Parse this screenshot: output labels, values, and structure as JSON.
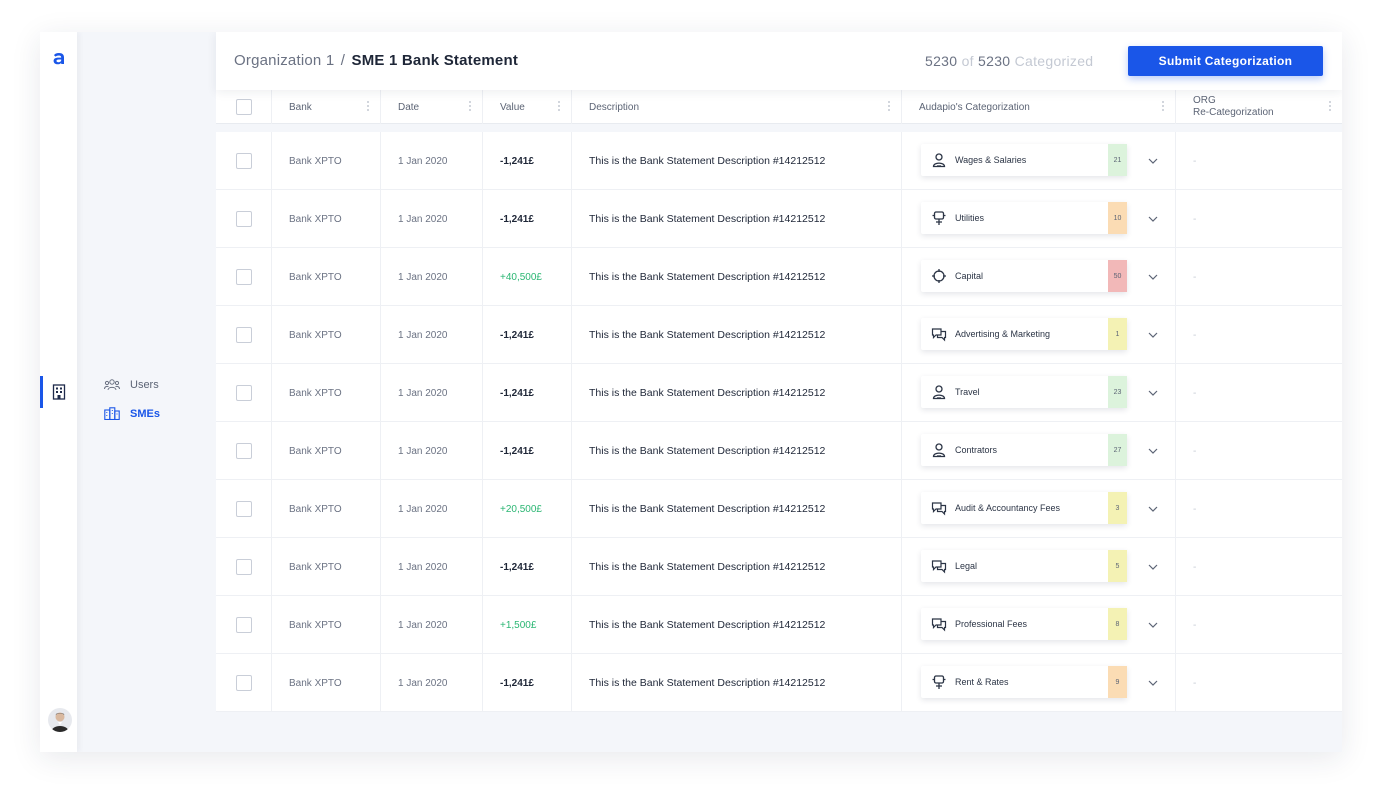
{
  "breadcrumb": {
    "parent": "Organization 1",
    "separator": "/",
    "current": "SME 1 Bank Statement"
  },
  "progress": {
    "done": "5230",
    "of": "of",
    "total": "5230",
    "label": "Categorized"
  },
  "submit_label": "Submit Categorization",
  "nav": {
    "users_label": "Users",
    "smes_label": "SMEs"
  },
  "columns": {
    "bank": "Bank",
    "date": "Date",
    "value": "Value",
    "description": "Description",
    "categorization": "Audapio's Categorization",
    "org_line1": "ORG",
    "org_line2": "Re-Categorization"
  },
  "colors": {
    "accent": "#1a56e8",
    "positive": "#2bb673",
    "badge_green": "#dcf3dc",
    "badge_orange": "#fbdcb4",
    "badge_red": "#f2b8b8",
    "badge_yellow": "#f4f2b4"
  },
  "rows": [
    {
      "bank": "Bank XPTO",
      "date": "1 Jan 2020",
      "value": "-1,241£",
      "positive": false,
      "description": "This is the Bank Statement Description #14212512",
      "category": "Wages & Salaries",
      "icon": "person-icon",
      "score": "21",
      "badge": "green",
      "org": "-"
    },
    {
      "bank": "Bank XPTO",
      "date": "1 Jan 2020",
      "value": "-1,241£",
      "positive": false,
      "description": "This is the Bank Statement Description #14212512",
      "category": "Utilities",
      "icon": "plug-icon",
      "score": "10",
      "badge": "orange",
      "org": "-"
    },
    {
      "bank": "Bank XPTO",
      "date": "1 Jan 2020",
      "value": "+40,500£",
      "positive": true,
      "description": "This is the Bank Statement Description #14212512",
      "category": "Capital",
      "icon": "crosshair-icon",
      "score": "50",
      "badge": "red",
      "org": "-"
    },
    {
      "bank": "Bank XPTO",
      "date": "1 Jan 2020",
      "value": "-1,241£",
      "positive": false,
      "description": "This is the Bank Statement Description #14212512",
      "category": "Advertising & Marketing",
      "icon": "chat-icon",
      "score": "1",
      "badge": "yellow",
      "org": "-"
    },
    {
      "bank": "Bank XPTO",
      "date": "1 Jan 2020",
      "value": "-1,241£",
      "positive": false,
      "description": "This is the Bank Statement Description #14212512",
      "category": "Travel",
      "icon": "person-icon",
      "score": "23",
      "badge": "green",
      "org": "-"
    },
    {
      "bank": "Bank XPTO",
      "date": "1 Jan 2020",
      "value": "-1,241£",
      "positive": false,
      "description": "This is the Bank Statement Description #14212512",
      "category": "Contrators",
      "icon": "person-icon",
      "score": "27",
      "badge": "green",
      "org": "-"
    },
    {
      "bank": "Bank XPTO",
      "date": "1 Jan 2020",
      "value": "+20,500£",
      "positive": true,
      "description": "This is the Bank Statement Description #14212512",
      "category": "Audit & Accountancy Fees",
      "icon": "chat-icon",
      "score": "3",
      "badge": "yellow",
      "org": "-"
    },
    {
      "bank": "Bank XPTO",
      "date": "1 Jan 2020",
      "value": "-1,241£",
      "positive": false,
      "description": "This is the Bank Statement Description #14212512",
      "category": "Legal",
      "icon": "chat-icon",
      "score": "5",
      "badge": "yellow",
      "org": "-"
    },
    {
      "bank": "Bank XPTO",
      "date": "1 Jan 2020",
      "value": "+1,500£",
      "positive": true,
      "description": "This is the Bank Statement Description #14212512",
      "category": "Professional Fees",
      "icon": "chat-icon",
      "score": "8",
      "badge": "yellow",
      "org": "-"
    },
    {
      "bank": "Bank XPTO",
      "date": "1 Jan 2020",
      "value": "-1,241£",
      "positive": false,
      "description": "This is the Bank Statement Description #14212512",
      "category": "Rent & Rates",
      "icon": "plug-icon",
      "score": "9",
      "badge": "orange",
      "org": "-"
    }
  ]
}
